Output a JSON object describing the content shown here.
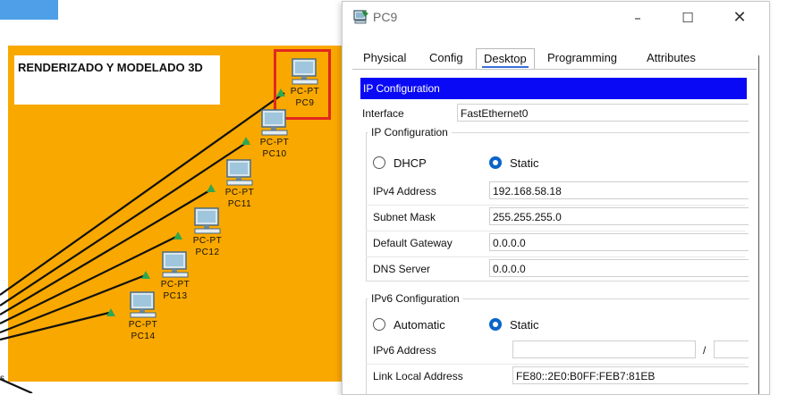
{
  "workspace": {
    "area_title": "RENDERIZADO Y MODELADO 3D",
    "selection_mark": "s",
    "devices": [
      {
        "model": "PC-PT",
        "name": "PC9"
      },
      {
        "model": "PC-PT",
        "name": "PC10"
      },
      {
        "model": "PC-PT",
        "name": "PC11"
      },
      {
        "model": "PC-PT",
        "name": "PC12"
      },
      {
        "model": "PC-PT",
        "name": "PC13"
      },
      {
        "model": "PC-PT",
        "name": "PC14"
      }
    ],
    "colors": {
      "area": "#f9a800",
      "highlight": "#e0281e",
      "link_up": "#2fa84f"
    }
  },
  "window": {
    "title": "PC9",
    "icon": "pc-icon",
    "controls": {
      "minimize": "–",
      "maximize": "☐",
      "close": "✕"
    },
    "tabs": [
      {
        "label": "Physical",
        "active": false
      },
      {
        "label": "Config",
        "active": false
      },
      {
        "label": "Desktop",
        "active": true
      },
      {
        "label": "Programming",
        "active": false
      },
      {
        "label": "Attributes",
        "active": false
      }
    ]
  },
  "ip_config": {
    "header": "IP Configuration",
    "interface_label": "Interface",
    "interface_value": "FastEthernet0",
    "ipv4_group": "IP Configuration",
    "dhcp_label": "DHCP",
    "static_label": "Static",
    "mode": "Static",
    "ipv4_address_label": "IPv4 Address",
    "ipv4_address": "192.168.58.18",
    "subnet_mask_label": "Subnet Mask",
    "subnet_mask": "255.255.255.0",
    "gateway_label": "Default Gateway",
    "gateway": "0.0.0.0",
    "dns_label": "DNS Server",
    "dns": "0.0.0.0",
    "ipv6_group": "IPv6 Configuration",
    "automatic_label": "Automatic",
    "static6_label": "Static",
    "ipv6_mode": "Static",
    "ipv6_address_label": "IPv6 Address",
    "ipv6_address": "",
    "ipv6_prefix_sep": "/",
    "ipv6_prefix": "",
    "link_local_label": "Link Local Address",
    "link_local": "FE80::2E0:B0FF:FEB7:81EB"
  },
  "accent": "#0a09f5"
}
